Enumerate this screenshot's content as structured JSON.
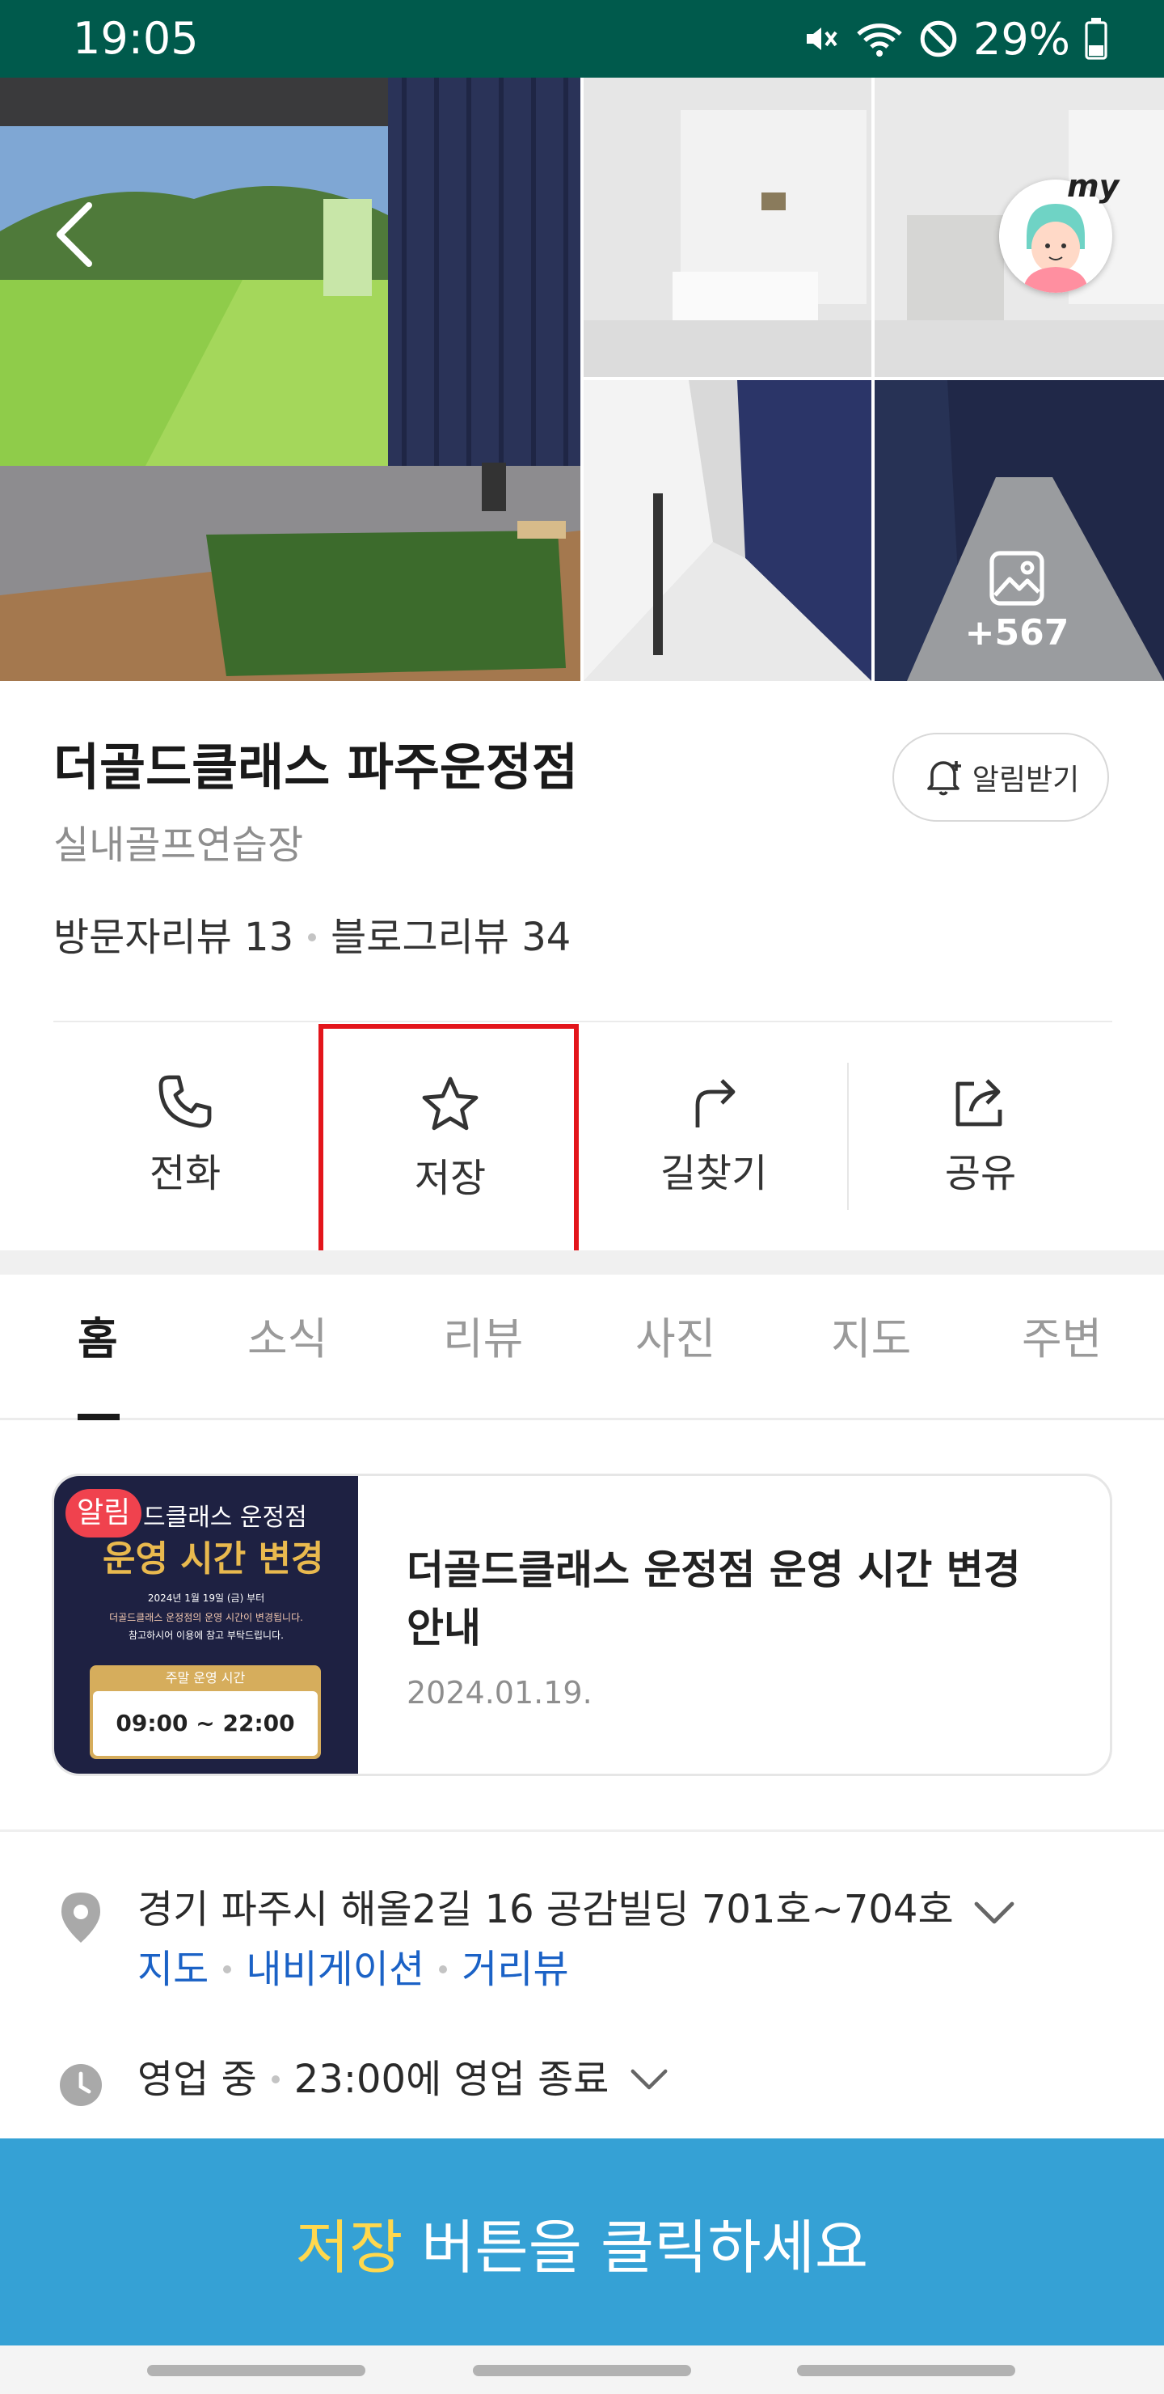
{
  "status_bar": {
    "time": "19:05",
    "battery": "29%"
  },
  "gallery": {
    "more_count": "+567",
    "avatar_badge": "my"
  },
  "place": {
    "name": "더골드클래스 파주운정점",
    "category": "실내골프연습장",
    "visitor_reviews": "방문자리뷰 13",
    "blog_reviews": "블로그리뷰 34",
    "alarm_label": "알림받기"
  },
  "actions": [
    {
      "label": "전화",
      "icon": "phone-icon"
    },
    {
      "label": "저장",
      "icon": "star-icon"
    },
    {
      "label": "길찾기",
      "icon": "directions-icon"
    },
    {
      "label": "공유",
      "icon": "share-icon"
    }
  ],
  "tabs": [
    "홈",
    "소식",
    "리뷰",
    "사진",
    "지도",
    "주변"
  ],
  "active_tab": "홈",
  "news": {
    "badge": "알림",
    "title": "더골드클래스 운정점 운영 시간 변경 안내",
    "date": "2024.01.19.",
    "thumb": {
      "heading_small": "드클래스 운정점",
      "heading_big": "운영 시간 변경",
      "line1": "2024년 1월 19일 (금) 부터",
      "line2": "더골드클래스 운정점의 운영 시간이 변경됩니다.",
      "line3": "참고하시어 이용에 참고 부탁드립니다.",
      "box_title": "주말 운영 시간",
      "box_hours": "09:00 ~ 22:00"
    }
  },
  "info": {
    "address": "경기 파주시 해올2길 16 공감빌딩 701호~704호",
    "links": [
      "지도",
      "내비게이션",
      "거리뷰"
    ],
    "status": "영업 중",
    "closing": "23:00에 영업 종료"
  },
  "tutorial": {
    "highlight": "저장",
    "rest": " 버튼을 클릭하세요"
  },
  "colors": {
    "status_bar": "#005a4c",
    "link": "#1b62c6",
    "highlight_box": "#e3151b",
    "banner": "#35a1d5",
    "banner_highlight": "#ffd84d",
    "badge": "#f0424e"
  }
}
